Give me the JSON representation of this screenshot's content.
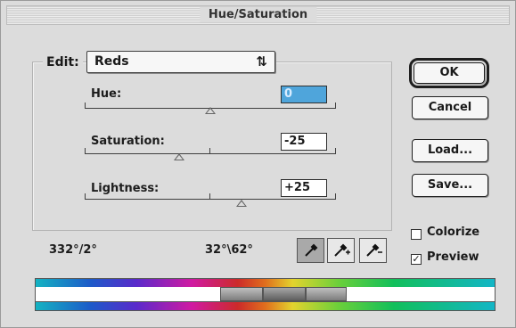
{
  "dialog": {
    "title": "Hue/Saturation"
  },
  "edit": {
    "label": "Edit:",
    "selected": "Reds",
    "arrow": "⇅"
  },
  "hue": {
    "label": "Hue:",
    "value": "0"
  },
  "saturation": {
    "label": "Saturation:",
    "value": "-25"
  },
  "lightness": {
    "label": "Lightness:",
    "value": "+25"
  },
  "buttons": {
    "ok": "OK",
    "cancel": "Cancel",
    "load": "Load...",
    "save": "Save..."
  },
  "checkboxes": {
    "colorize": {
      "label": "Colorize",
      "checked": false
    },
    "preview": {
      "label": "Preview",
      "checked": true,
      "mark": "✓"
    }
  },
  "ranges": {
    "left": "332°/2°",
    "right": "32°\\62°"
  },
  "eyedroppers": [
    "eyedropper-icon",
    "eyedropper-plus-icon",
    "eyedropper-minus-icon"
  ],
  "colors": {
    "selected_field": "#4fa5db",
    "background": "#dcdcdc"
  }
}
